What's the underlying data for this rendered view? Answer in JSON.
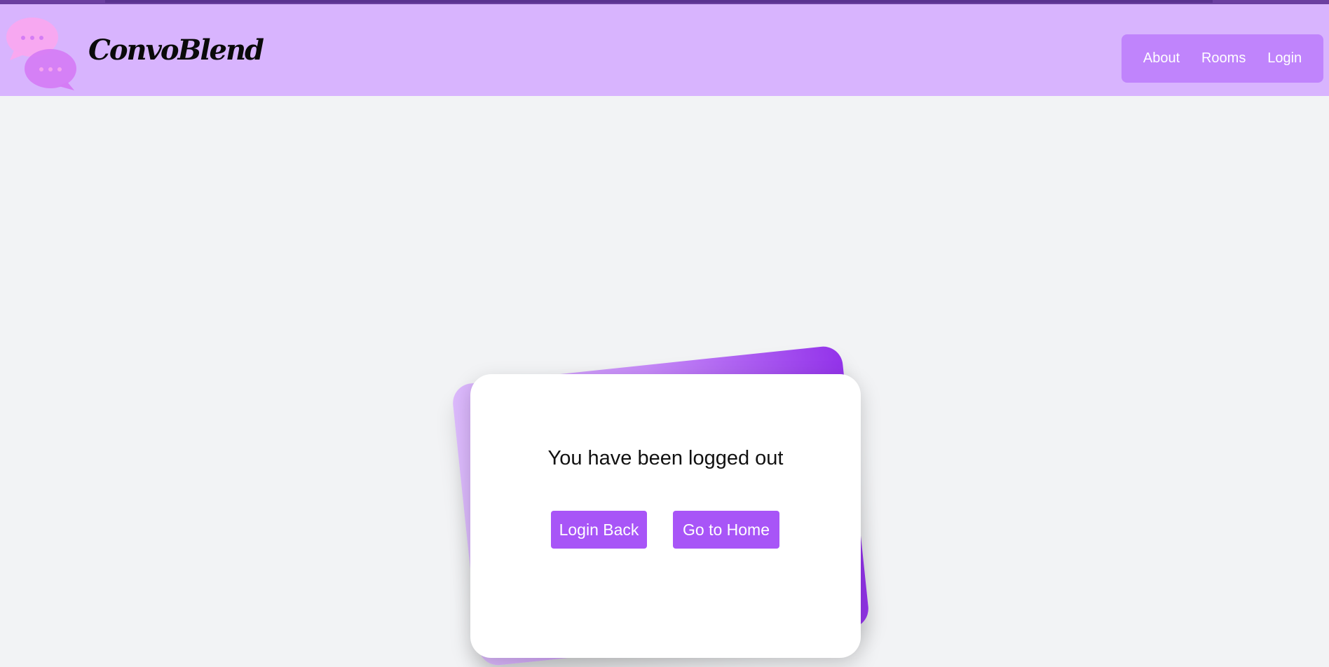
{
  "brand": {
    "name": "ConvoBlend",
    "logo_icon": "chat-bubbles-icon"
  },
  "nav": {
    "about": "About",
    "rooms": "Rooms",
    "login": "Login"
  },
  "logout": {
    "message": "You have been logged out",
    "login_back": "Login Back",
    "go_home": "Go to Home"
  },
  "colors": {
    "header_bg": "#d8b4fe",
    "nav_bg": "#c084fc",
    "button_bg": "#a855f7",
    "accent_deep": "#9333ea",
    "page_bg": "#f2f3f5"
  }
}
